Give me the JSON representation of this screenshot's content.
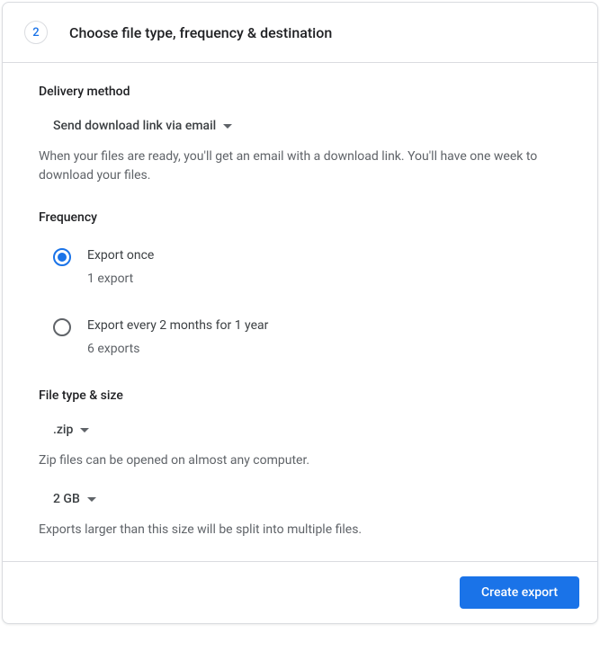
{
  "header": {
    "step_number": "2",
    "title": "Choose file type, frequency & destination"
  },
  "delivery": {
    "section_title": "Delivery method",
    "selected": "Send download link via email",
    "helper": "When your files are ready, you'll get an email with a download link. You'll have one week to download your files."
  },
  "frequency": {
    "section_title": "Frequency",
    "options": [
      {
        "label": "Export once",
        "sublabel": "1 export",
        "selected": true
      },
      {
        "label": "Export every 2 months for 1 year",
        "sublabel": "6 exports",
        "selected": false
      }
    ]
  },
  "file_type": {
    "section_title": "File type & size",
    "type_selected": ".zip",
    "type_helper": "Zip files can be opened on almost any computer.",
    "size_selected": "2 GB",
    "size_helper": "Exports larger than this size will be split into multiple files."
  },
  "footer": {
    "create_label": "Create export"
  }
}
